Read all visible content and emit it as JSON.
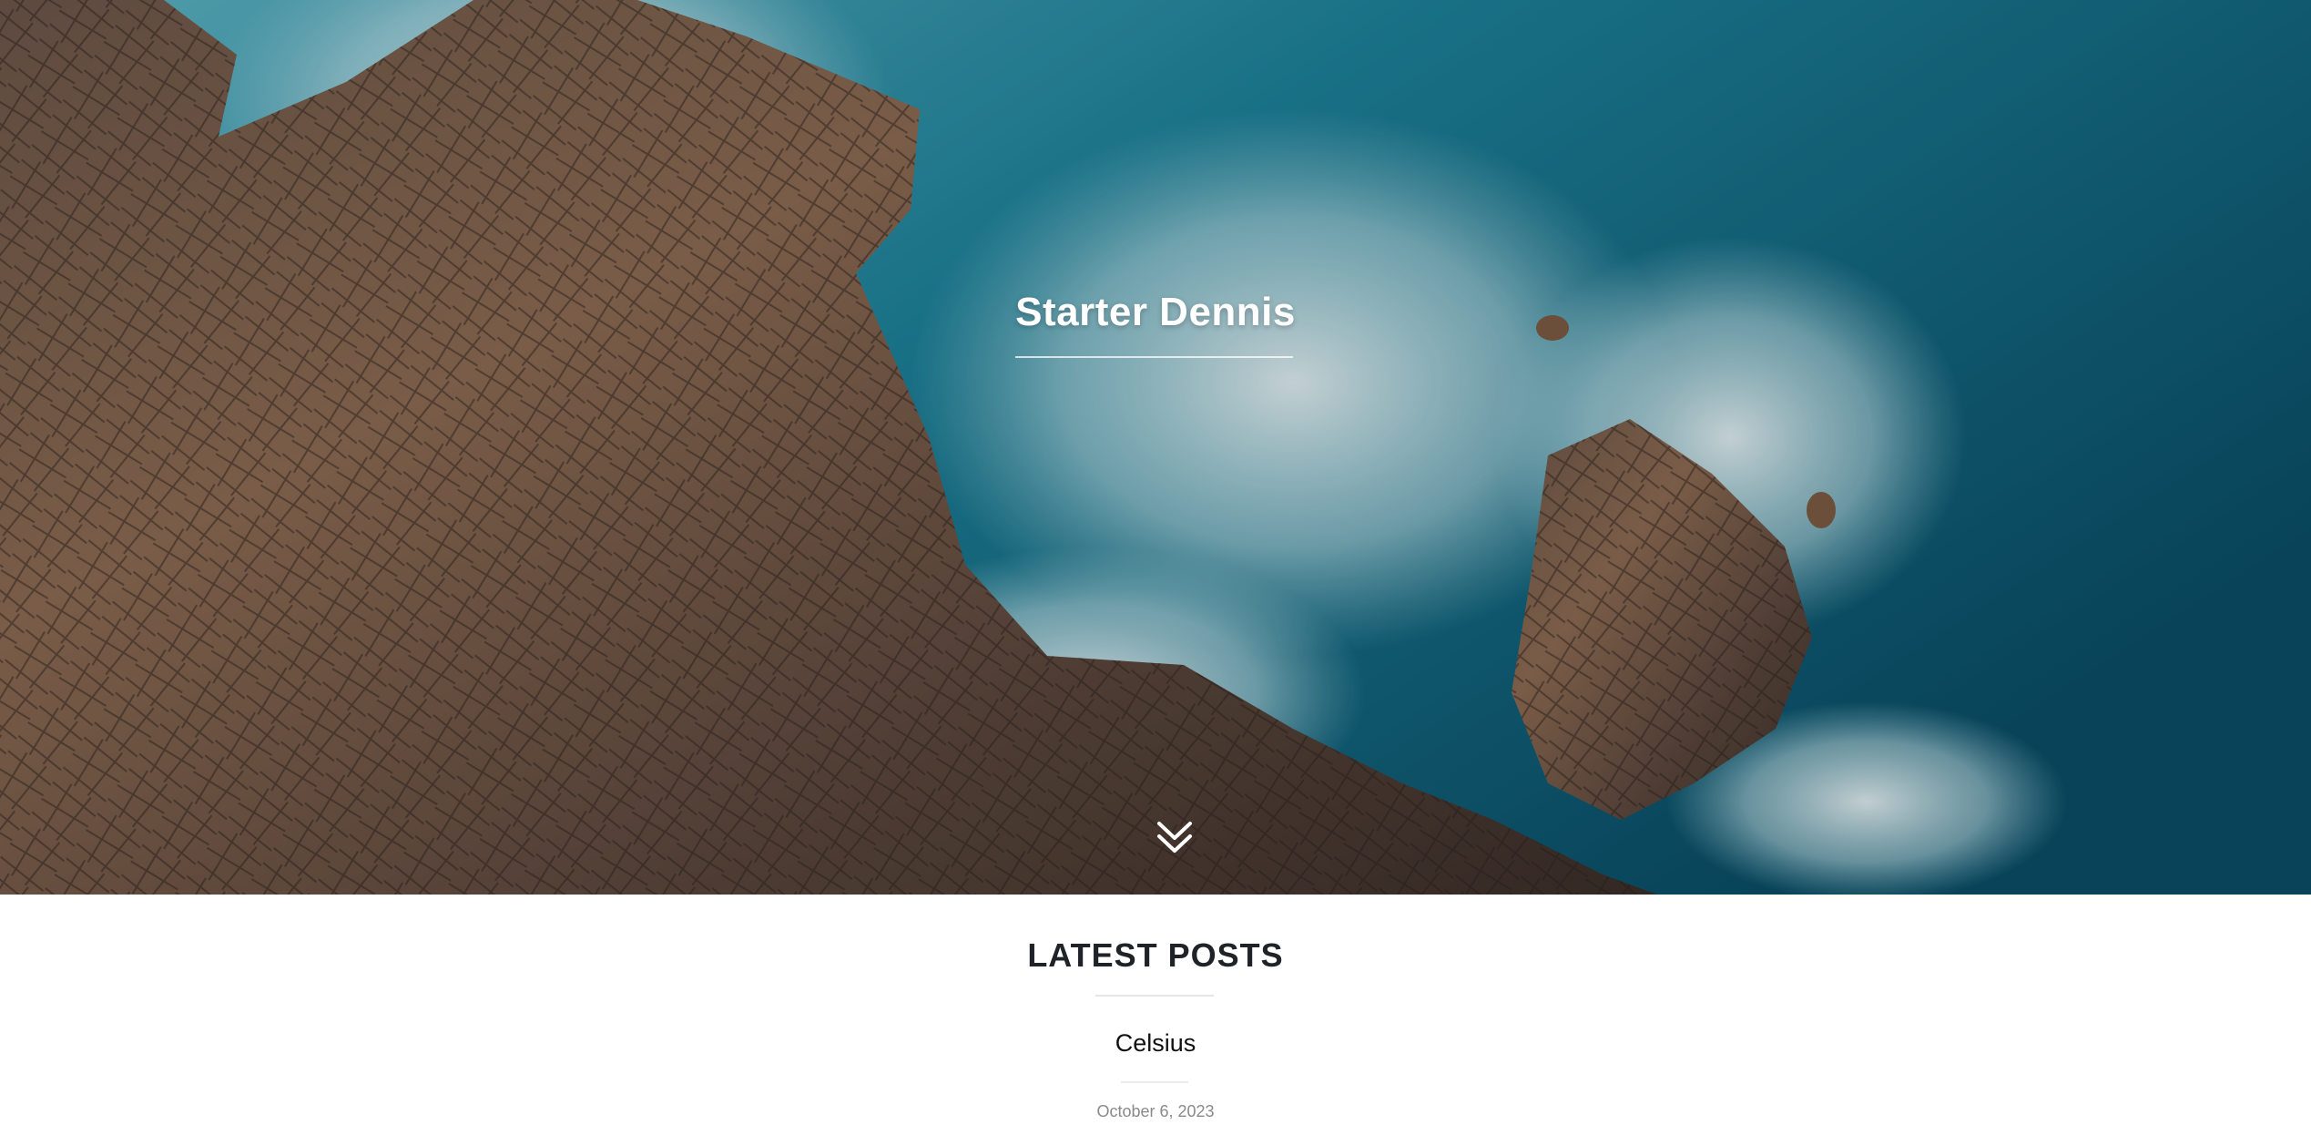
{
  "hero": {
    "title": "Starter Dennis",
    "scroll_icon": "double-chevron-down-icon",
    "background": "aerial-rocky-coast-ocean-image"
  },
  "latest": {
    "heading": "LATEST POSTS",
    "posts": [
      {
        "title": "Celsius",
        "date": "October 6, 2023"
      }
    ]
  },
  "colors": {
    "heading": "#1f2227",
    "date": "#8a8a8a",
    "ocean": "#0e5f75",
    "rock": "#8a5a3a"
  }
}
